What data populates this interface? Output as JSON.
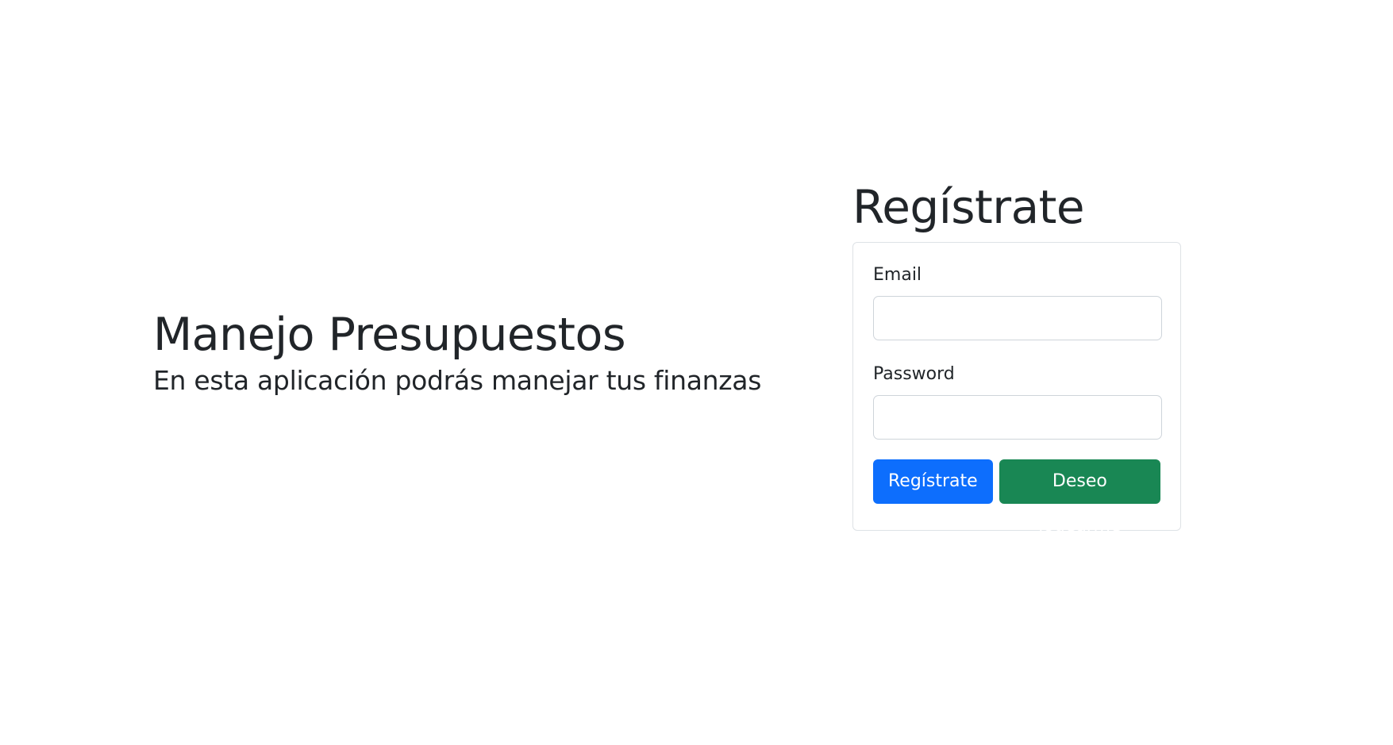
{
  "hero": {
    "title": "Manejo Presupuestos",
    "subtitle": "En esta aplicación podrás manejar tus finanzas"
  },
  "register": {
    "title": "Regístrate",
    "email": {
      "label": "Email",
      "value": "",
      "placeholder": ""
    },
    "password": {
      "label": "Password",
      "value": "",
      "placeholder": ""
    },
    "submit_label": "Regístrate",
    "login_label": "Deseo logearme"
  },
  "colors": {
    "primary": "#0d6efd",
    "success": "#198754",
    "text": "#212529",
    "border": "#dee2e6"
  }
}
